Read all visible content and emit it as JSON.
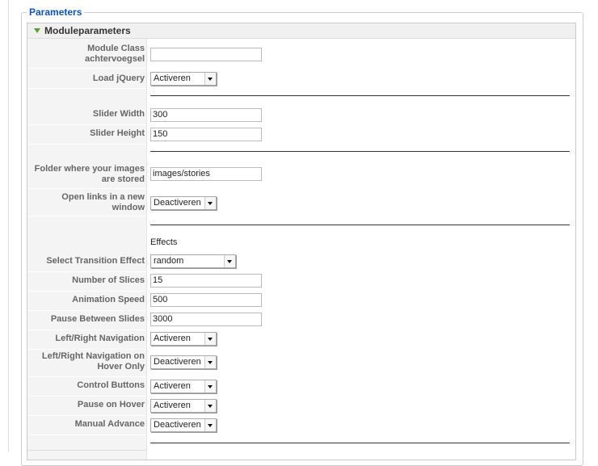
{
  "fieldset": {
    "legend": "Parameters"
  },
  "panel": {
    "title": "Moduleparameters"
  },
  "fields": {
    "module_class_suffix": {
      "label_line1": "Module Class",
      "label_line2": "achtervoegsel",
      "value": ""
    },
    "load_jquery": {
      "label": "Load jQuery",
      "value": "Activeren"
    },
    "slider_width": {
      "label": "Slider Width",
      "value": "300"
    },
    "slider_height": {
      "label": "Slider Height",
      "value": "150"
    },
    "images_folder": {
      "label_line1": "Folder where your images",
      "label_line2": "are stored",
      "value": "images/stories"
    },
    "open_links_new_window": {
      "label_line1": "Open links in a new",
      "label_line2": "window",
      "value": "Deactiveren"
    },
    "effects_heading": "Effects",
    "transition_effect": {
      "label": "Select Transition Effect",
      "value": "random"
    },
    "number_of_slices": {
      "label": "Number of Slices",
      "value": "15"
    },
    "animation_speed": {
      "label": "Animation Speed",
      "value": "500"
    },
    "pause_between_slides": {
      "label": "Pause Between Slides",
      "value": "3000"
    },
    "lr_navigation": {
      "label": "Left/Right Navigation",
      "value": "Activeren"
    },
    "lr_navigation_hover": {
      "label_line1": "Left/Right Navigation on",
      "label_line2": "Hover Only",
      "value": "Deactiveren"
    },
    "control_buttons": {
      "label": "Control Buttons",
      "value": "Activeren"
    },
    "pause_on_hover": {
      "label": "Pause on Hover",
      "value": "Activeren"
    },
    "manual_advance": {
      "label": "Manual Advance",
      "value": "Deactiveren"
    }
  }
}
